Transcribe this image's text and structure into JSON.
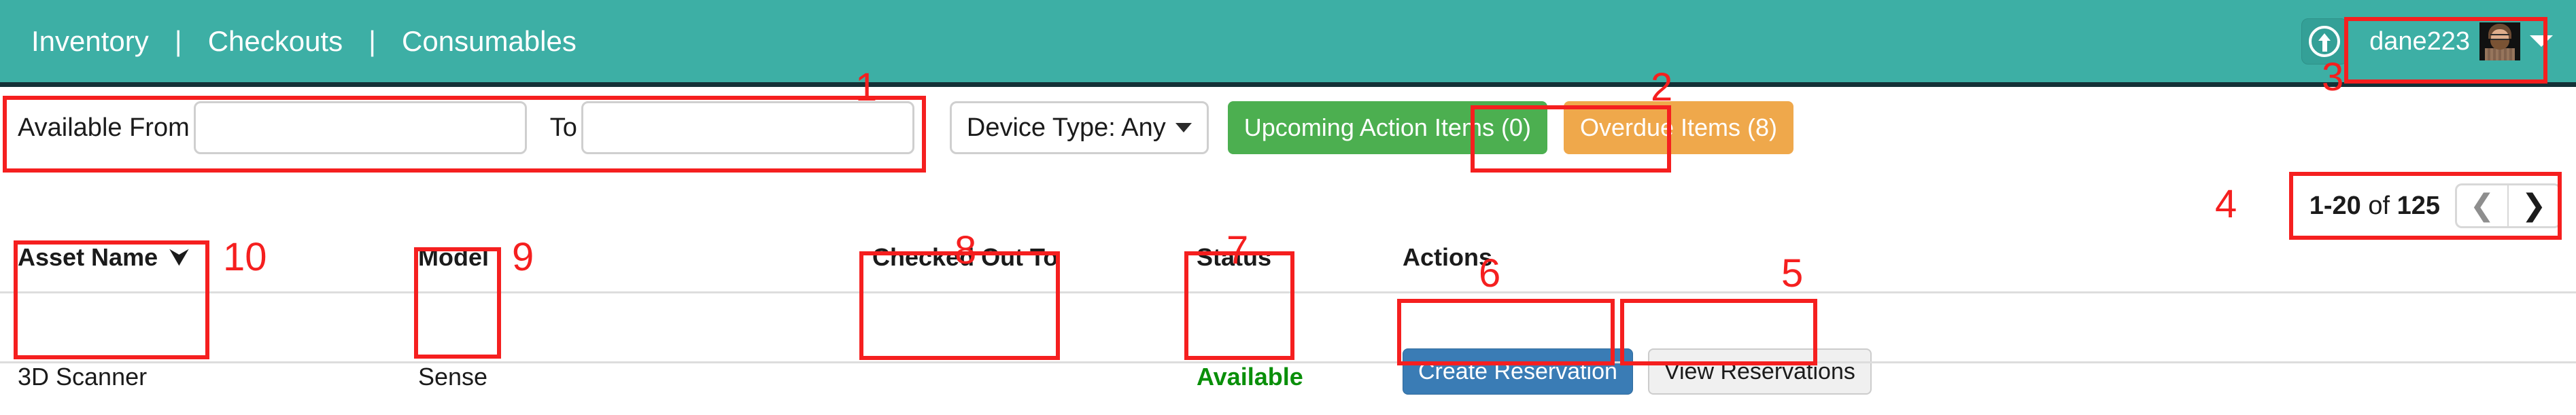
{
  "header": {
    "nav_items": [
      "Inventory",
      "Checkouts",
      "Consumables"
    ],
    "separator": "|",
    "upload_icon": "arrow-up-circle-icon",
    "user": {
      "name": "dane223",
      "avatar": "user-avatar-photo",
      "caret": "chevron-down-icon"
    },
    "colors": {
      "bar": "#3dafa5",
      "bar_border": "#143137"
    }
  },
  "filters": {
    "available_from_label": "Available From",
    "available_from_value": "",
    "available_from_placeholder": "",
    "to_label": "To",
    "to_value": "",
    "to_placeholder": "",
    "device_type_label": "Device Type: Any",
    "upcoming_action_items": "Upcoming Action Items (0)",
    "overdue_items": "Overdue Items (8)",
    "colors": {
      "green": "#4caf50",
      "orange": "#efa84b"
    }
  },
  "pagination": {
    "range": "1-20",
    "of": " of ",
    "total": "125",
    "prev_icon": "chevron-left-icon",
    "next_icon": "chevron-right-icon",
    "prev_glyph": "❮",
    "next_glyph": "❯"
  },
  "table": {
    "columns": [
      {
        "key": "asset_name",
        "label": "Asset Name",
        "sorted": true,
        "sort_glyph": "⮟"
      },
      {
        "key": "model",
        "label": "Model",
        "sorted": false
      },
      {
        "key": "checked_out_to",
        "label": "Checked Out To",
        "sorted": false
      },
      {
        "key": "status",
        "label": "Status",
        "sorted": false
      },
      {
        "key": "actions",
        "label": "Actions",
        "sorted": false
      }
    ],
    "rows": [
      {
        "asset_name": "3D Scanner",
        "model": "Sense",
        "checked_out_to": "",
        "status": "Available",
        "status_color": "#0a8f0a",
        "action_primary": "Create Reservation",
        "action_secondary": "View Reservations"
      }
    ]
  },
  "annotations": {
    "color": "#f51f1f",
    "labels": {
      "n1": "1",
      "n2": "2",
      "n3": "3",
      "n4": "4",
      "n5": "5",
      "n6": "6",
      "n7": "7",
      "n8": "8",
      "n9": "9",
      "n10": "10"
    }
  }
}
